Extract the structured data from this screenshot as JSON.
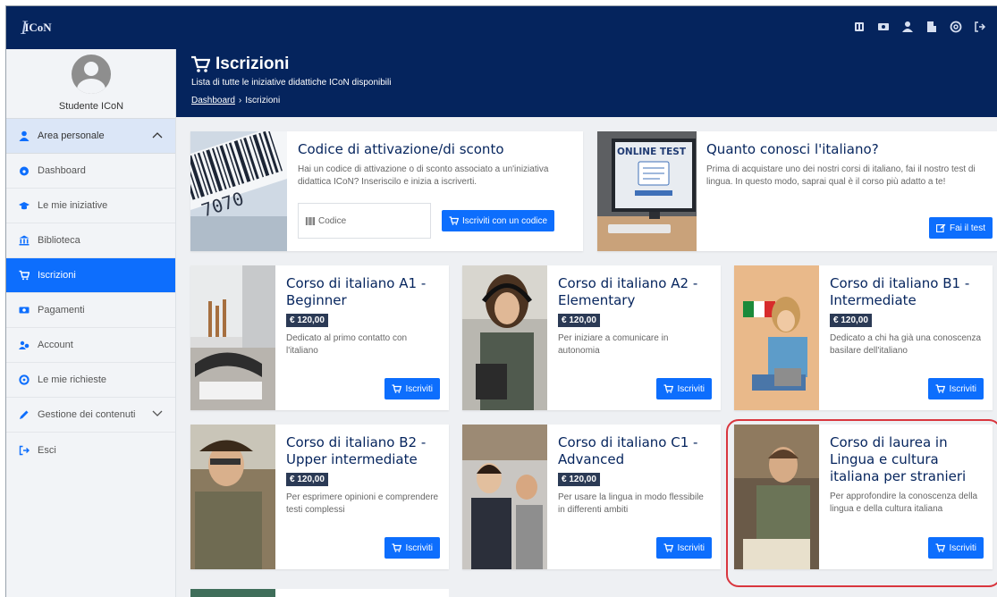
{
  "app": {
    "logo_text": "ICoN"
  },
  "header": {
    "title": "Iscrizioni",
    "subtitle": "Lista di tutte le iniziative didattiche ICoN disponibili",
    "breadcrumb": {
      "home": "Dashboard",
      "sep": "›",
      "current": "Iscrizioni"
    }
  },
  "profile": {
    "name": "Studente ICoN"
  },
  "sidebar": {
    "group": "Area personale",
    "items": [
      {
        "label": "Dashboard",
        "icon": "dashboard-icon"
      },
      {
        "label": "Le mie iniziative",
        "icon": "graduation-cap-icon"
      },
      {
        "label": "Biblioteca",
        "icon": "library-icon"
      },
      {
        "label": "Iscrizioni",
        "icon": "cart-icon",
        "active": true
      },
      {
        "label": "Pagamenti",
        "icon": "money-icon"
      },
      {
        "label": "Account",
        "icon": "users-icon"
      },
      {
        "label": "Le mie richieste",
        "icon": "lifebuoy-icon"
      }
    ],
    "content_group": "Gestione dei contenuti",
    "exit": "Esci"
  },
  "activation": {
    "title": "Codice di attivazione/di sconto",
    "desc": "Hai un codice di attivazione o di sconto associato a un'iniziativa didattica ICoN? Inseriscilo e inizia a iscriverti.",
    "input_placeholder": "Codice",
    "button": "Iscriviti con un codice"
  },
  "test": {
    "title": "Quanto conosci l'italiano?",
    "desc": "Prima di acquistare uno dei nostri corsi di italiano, fai il nostro test di lingua. In questo modo, saprai qual è il corso più adatto a te!",
    "button": "Fai il test",
    "image_label": "ONLINE TEST"
  },
  "courses": [
    {
      "title": "Corso di italiano A1 - Beginner",
      "price": "€ 120,00",
      "desc": "Dedicato al primo contatto con l'italiano",
      "button": "Iscriviti"
    },
    {
      "title": "Corso di italiano A2 - Elementary",
      "price": "€ 120,00",
      "desc": "Per iniziare a comunicare in autonomia",
      "button": "Iscriviti"
    },
    {
      "title": "Corso di italiano B1 - Intermediate",
      "price": "€ 120,00",
      "desc": "Dedicato a chi ha già una conoscenza basilare dell'italiano",
      "button": "Iscriviti"
    },
    {
      "title": "Corso di italiano B2 - Upper intermediate",
      "price": "€ 120,00",
      "desc": "Per esprimere opinioni e comprendere testi complessi",
      "button": "Iscriviti"
    },
    {
      "title": "Corso di italiano C1 - Advanced",
      "price": "€ 120,00",
      "desc": "Per usare la lingua in modo flessibile in differenti ambiti",
      "button": "Iscriviti"
    },
    {
      "title": "Corso di laurea in Lingua e cultura italiana per stranieri",
      "desc": "Per approfondire la conoscenza della lingua e della cultura italiana",
      "button": "Iscriviti"
    }
  ],
  "colors": {
    "navy": "#05245d",
    "primary": "#0d6efd",
    "price_bg": "#2b3a55",
    "highlight": "#d9363e"
  }
}
